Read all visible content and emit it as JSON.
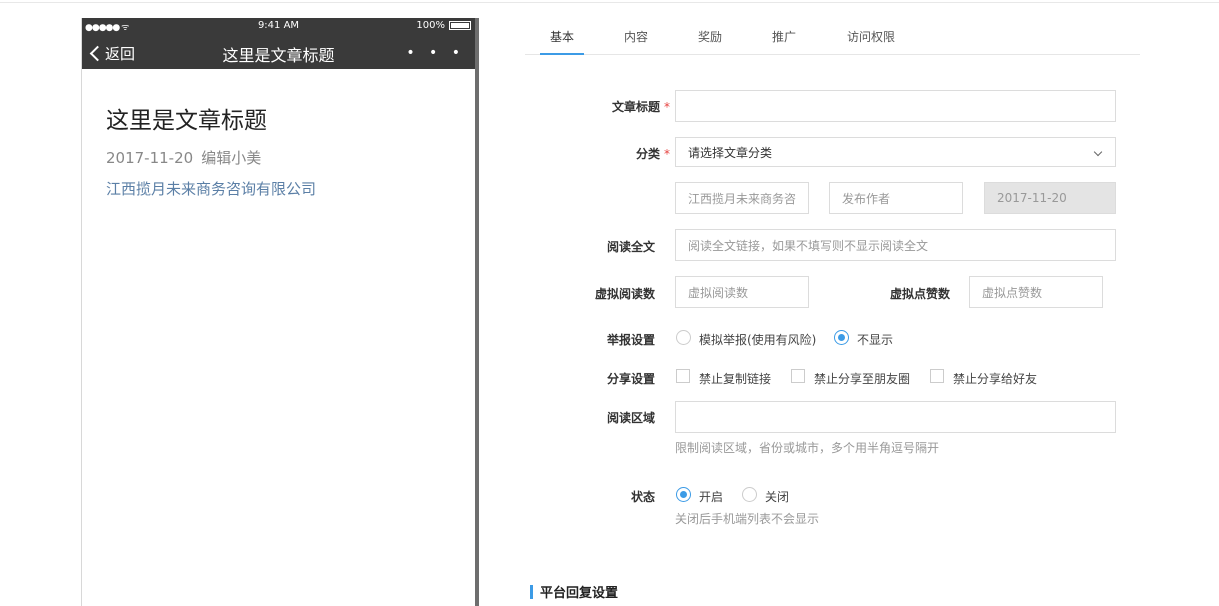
{
  "phone": {
    "status": {
      "signal": "●●●●● ᯤ",
      "time": "9:41 AM",
      "battery": "100%"
    },
    "nav": {
      "back_label": "返回",
      "title": "这里是文章标题",
      "more": "• • •"
    },
    "article": {
      "title": "这里是文章标题",
      "date": "2017-11-20",
      "author": "编辑小美",
      "org": "江西揽月未来商务咨询有限公司"
    }
  },
  "tabs": [
    {
      "label": "基本",
      "active": true
    },
    {
      "label": "内容"
    },
    {
      "label": "奖励"
    },
    {
      "label": "推广"
    },
    {
      "label": "访问权限"
    }
  ],
  "form": {
    "title": {
      "label": "文章标题",
      "required": "*",
      "value": ""
    },
    "category": {
      "label": "分类",
      "required": "*",
      "placeholder": "请选择文章分类"
    },
    "publisher": {
      "value": "江西揽月未来商务咨"
    },
    "author": {
      "placeholder": "发布作者"
    },
    "date": {
      "value": "2017-11-20"
    },
    "read_more": {
      "label": "阅读全文",
      "placeholder": "阅读全文链接，如果不填写则不显示阅读全文"
    },
    "virtual_reads": {
      "label": "虚拟阅读数",
      "placeholder": "虚拟阅读数"
    },
    "virtual_likes": {
      "label": "虚拟点赞数",
      "placeholder": "虚拟点赞数"
    },
    "report": {
      "label": "举报设置",
      "options": [
        "模拟举报(使用有风险)",
        "不显示"
      ],
      "selected": "不显示"
    },
    "share": {
      "label": "分享设置",
      "options": [
        "禁止复制链接",
        "禁止分享至朋友圈",
        "禁止分享给好友"
      ]
    },
    "region": {
      "label": "阅读区域",
      "value": "",
      "hint": "限制阅读区域，省份或城市，多个用半角逗号隔开"
    },
    "status": {
      "label": "状态",
      "options": [
        "开启",
        "关闭"
      ],
      "selected": "开启",
      "hint": "关闭后手机端列表不会显示"
    }
  },
  "section": {
    "title": "平台回复设置"
  },
  "colors": {
    "accent": "#3c9be6",
    "nav_bg": "#3a3a3a",
    "required": "#e64340"
  }
}
